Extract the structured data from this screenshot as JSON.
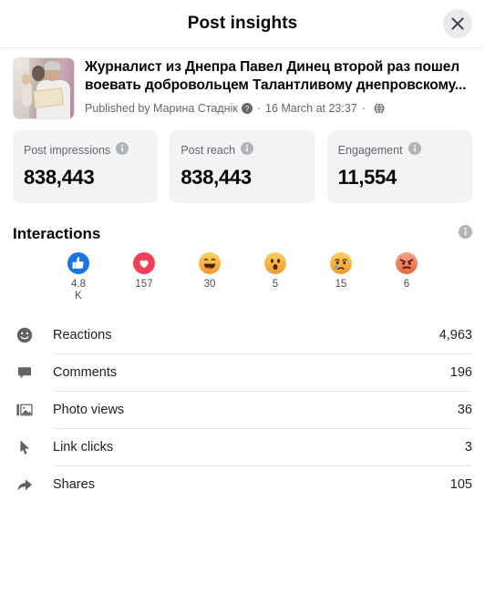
{
  "header": {
    "title": "Post insights",
    "close_label": "Close",
    "close_icon": "close-icon"
  },
  "post": {
    "thumbnail_alt": "Post photo thumbnail",
    "title": "Журналист из Днепра Павел Динец второй раз пошел воевать добровольцем Талантливому днепровскому...",
    "meta": {
      "published_by": "Published by Марина Стаднік",
      "verified_icon": "verified-badge-icon",
      "separator": "·",
      "date": "16 March at 23:37",
      "privacy_icon": "globe-icon"
    }
  },
  "metrics": [
    {
      "label": "Post impressions",
      "value": "838,443",
      "info_icon": "info-icon"
    },
    {
      "label": "Post reach",
      "value": "838,443",
      "info_icon": "info-icon"
    },
    {
      "label": "Engagement",
      "value": "11,554",
      "info_icon": "info-icon"
    }
  ],
  "interactions": {
    "title": "Interactions",
    "info_icon": "info-icon",
    "reactions": [
      {
        "name": "like",
        "icon": "thumbs-up-icon",
        "count": "4.8 K",
        "color": "#1b74e4"
      },
      {
        "name": "love",
        "icon": "heart-icon",
        "count": "157",
        "color": "#f33e58"
      },
      {
        "name": "haha",
        "icon": "laughing-face-icon",
        "count": "30",
        "color": "#f7b125"
      },
      {
        "name": "wow",
        "icon": "surprised-face-icon",
        "count": "5",
        "color": "#f7b125"
      },
      {
        "name": "sad",
        "icon": "crying-face-icon",
        "count": "15",
        "color": "#f7b125"
      },
      {
        "name": "angry",
        "icon": "angry-face-icon",
        "count": "6",
        "color": "#e8663f"
      }
    ],
    "rows": [
      {
        "label": "Reactions",
        "value": "4,963",
        "icon": "smiley-face-icon"
      },
      {
        "label": "Comments",
        "value": "196",
        "icon": "comment-bubble-icon"
      },
      {
        "label": "Photo views",
        "value": "36",
        "icon": "photo-stack-icon"
      },
      {
        "label": "Link clicks",
        "value": "3",
        "icon": "cursor-arrow-icon"
      },
      {
        "label": "Shares",
        "value": "105",
        "icon": "share-arrow-icon"
      }
    ]
  }
}
